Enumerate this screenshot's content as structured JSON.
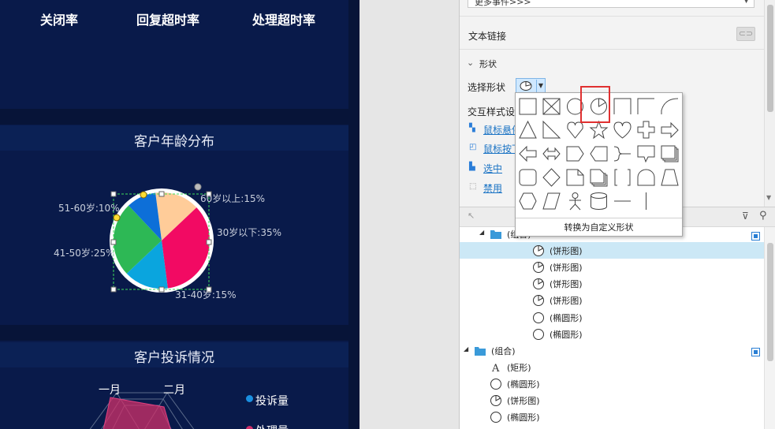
{
  "dashboard": {
    "metrics": [
      "关闭率",
      "回复超时率",
      "处理超时率"
    ],
    "age_title": "客户年龄分布",
    "complaint_title": "客户投诉情况",
    "radar_labels": [
      "一月",
      "二月"
    ],
    "legend": [
      {
        "label": "投诉量",
        "color": "#1a8fe0"
      },
      {
        "label": "处理量",
        "color": "#d0306a"
      }
    ]
  },
  "chart_data": {
    "type": "pie",
    "title": "客户年龄分布",
    "slices": [
      {
        "label": "60岁以上:15%",
        "value": 15,
        "color": "#ffcc99"
      },
      {
        "label": "30岁以下:35%",
        "value": 35,
        "color": "#f20a63"
      },
      {
        "label": "31-40岁:15%",
        "value": 15,
        "color": "#0aa5de"
      },
      {
        "label": "41-50岁:25%",
        "value": 25,
        "color": "#2db855"
      },
      {
        "label": "51-60岁:10%",
        "value": 10,
        "color": "#0d6fd8"
      }
    ]
  },
  "inspector": {
    "dropdown_value": "更多事件>>>",
    "text_link_label": "文本链接",
    "shape_section_label": "形状",
    "choose_shape_label": "选择形状",
    "interaction_style_label": "交互样式设",
    "interactions": [
      "鼠标悬停",
      "鼠标按下",
      "选中",
      "禁用"
    ],
    "shape_icons": [
      "rectangle-icon",
      "crossed-box-icon",
      "ellipse-icon",
      "pie-icon",
      "rect-top-edge-icon",
      "rect-corner-icon",
      "curved-corner-icon",
      "triangle-icon",
      "right-triangle-icon",
      "heart-bubble-icon",
      "star-icon",
      "heart-icon",
      "plus-icon",
      "arrow-right-icon",
      "arrow-left-icon",
      "double-arrow-icon",
      "pentagon-tag-icon",
      "chevron-tag-icon",
      "brace-icon",
      "callout-icon",
      "stack-icon",
      "rounded-rect-icon",
      "diamond-icon",
      "folded-page-icon",
      "pages-icon",
      "bracket-icon",
      "semicircle-icon",
      "trapezoid-icon",
      "hexagon-icon",
      "parallelogram-icon",
      "person-icon",
      "database-icon",
      "horizontal-line-icon",
      "vertical-line-icon"
    ],
    "convert_button": "转换为自定义形状"
  },
  "outline": {
    "rows": [
      {
        "label": "(组合)",
        "icon": "folder-icon",
        "indent": 1
      },
      {
        "label": "(饼形图)",
        "icon": "pie-icon",
        "indent": 2,
        "selected": true
      },
      {
        "label": "(饼形图)",
        "icon": "pie-icon",
        "indent": 2
      },
      {
        "label": "(饼形图)",
        "icon": "pie-icon",
        "indent": 2
      },
      {
        "label": "(饼形图)",
        "icon": "pie-icon",
        "indent": 2
      },
      {
        "label": "(椭圆形)",
        "icon": "ellipse-icon",
        "indent": 2
      },
      {
        "label": "(椭圆形)",
        "icon": "ellipse-icon",
        "indent": 2
      },
      {
        "label": "(组合)",
        "icon": "folder-icon",
        "indent": 0
      },
      {
        "label": "(矩形)",
        "icon": "text-a-icon",
        "indent": 1
      },
      {
        "label": "(椭圆形)",
        "icon": "ellipse-icon",
        "indent": 1
      },
      {
        "label": "(饼形图)",
        "icon": "pie-icon",
        "indent": 1
      },
      {
        "label": "(椭圆形)",
        "icon": "ellipse-icon",
        "indent": 1
      }
    ]
  }
}
